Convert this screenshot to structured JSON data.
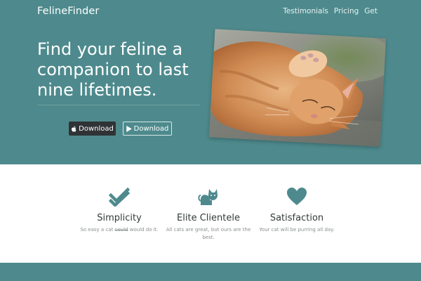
{
  "brand": {
    "name": "FelineFinder"
  },
  "nav": {
    "items": [
      "Testimonials",
      "Pricing",
      "Get"
    ]
  },
  "hero": {
    "headline": "Find your feline a companion to last nine lifetimes.",
    "buttons": {
      "apple_label": "Download",
      "play_label": "Download"
    }
  },
  "features": [
    {
      "icon": "checkmark-icon",
      "title": "Simplicity",
      "desc_pre": "So easy a cat ",
      "desc_strike": "could",
      "desc_post": " would do it."
    },
    {
      "icon": "cat-icon",
      "title": "Elite Clientele",
      "desc": "All cats are great, but ours are the best."
    },
    {
      "icon": "heart-icon",
      "title": "Satisfaction",
      "desc": "Your cat will be purring all day."
    }
  ],
  "colors": {
    "brand_teal": "#4e8a8d",
    "dark_button": "#2f3335",
    "icon_teal": "#4e8a8d"
  }
}
